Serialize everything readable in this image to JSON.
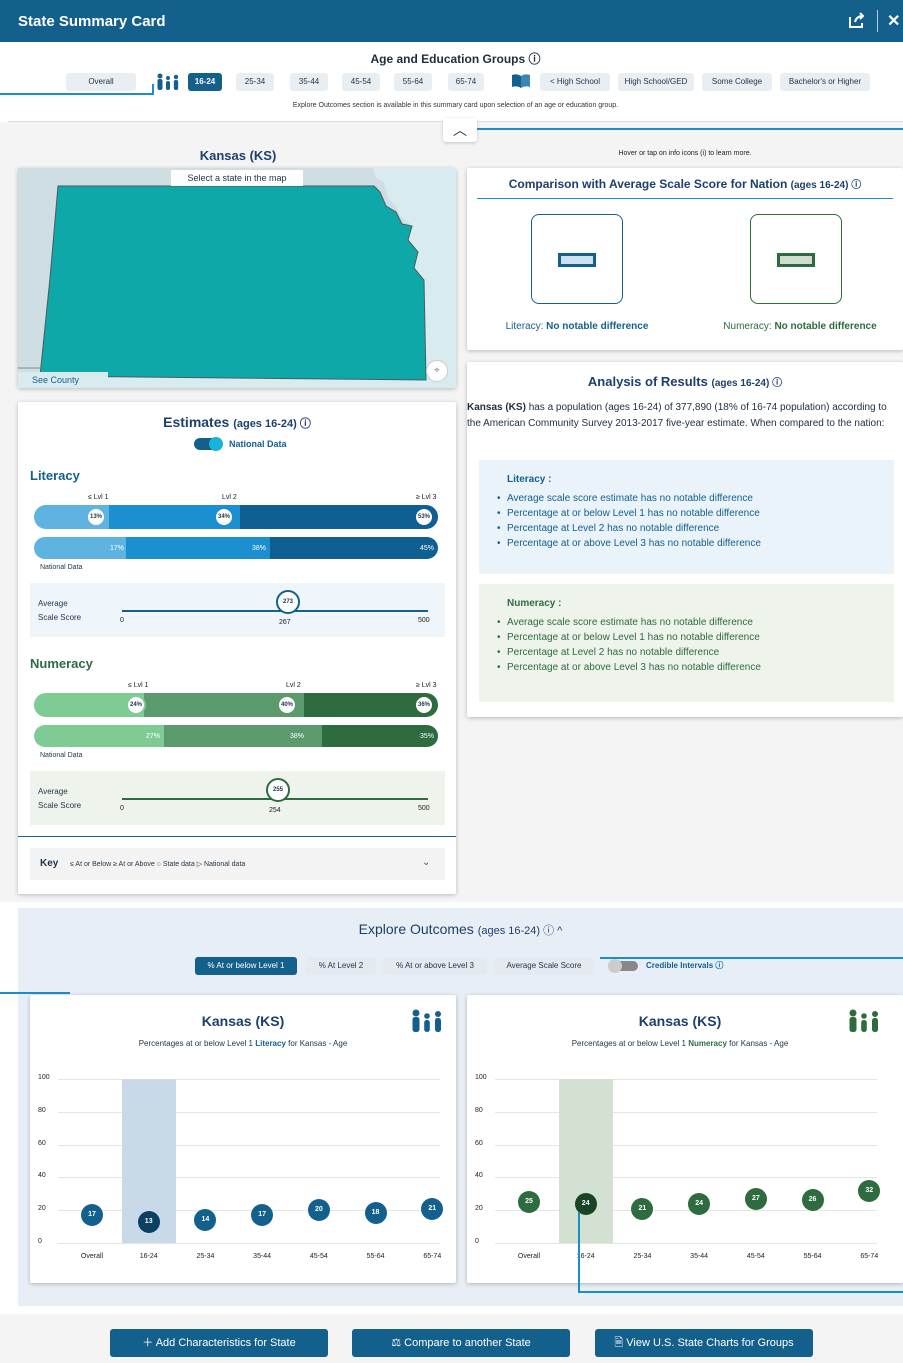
{
  "window": {
    "title": "State Summary Card"
  },
  "groups": {
    "title": "Age and Education Groups ⓘ",
    "overall": "Overall",
    "ages": [
      "16-24",
      "25-34",
      "35-44",
      "45-54",
      "55-64",
      "65-74"
    ],
    "selected_age": "16-24",
    "education": [
      "< High School",
      "High School/GED",
      "Some College",
      "Bachelor's or Higher"
    ],
    "note": "Explore Outcomes section is available in this summary card upon selection of an age or education group."
  },
  "hint": "Hover or tap on info icons (i) to learn more.",
  "map": {
    "state_title": "Kansas (KS)",
    "prompt": "Select a state in the map",
    "see_county": "See County"
  },
  "comparison": {
    "title": "Comparison with Average Scale Score for Nation",
    "title_suffix": "(ages 16-24) ⓘ",
    "literacy_label": "Literacy:",
    "literacy_value": "No notable difference",
    "numeracy_label": "Numeracy:",
    "numeracy_value": "No notable difference"
  },
  "analysis": {
    "title": "Analysis of Results",
    "title_suffix": "(ages 16-24) ⓘ",
    "state_bold": "Kansas (KS)",
    "intro": "has a population (ages 16-24) of 377,890 (18% of 16-74 population) according to the American Community Survey 2013-2017 five-year estimate. When compared to the nation:",
    "literacy_heading": "Literacy :",
    "literacy_items": [
      "Average scale score estimate has no notable difference",
      "Percentage at or below Level 1 has no notable difference",
      "Percentage at Level 2 has no notable difference",
      "Percentage at or above Level 3 has no notable difference"
    ],
    "numeracy_heading": "Numeracy :",
    "numeracy_items": [
      "Average scale score estimate has no notable difference",
      "Percentage at or below Level 1 has no notable difference",
      "Percentage at Level 2 has no notable difference",
      "Percentage at or above Level 3 has no notable difference"
    ]
  },
  "estimates": {
    "title": "Estimates",
    "title_suffix": "(ages 16-24) ⓘ",
    "toggle_label": "National Data",
    "level_labels": [
      "≤ Lvl 1",
      "Lvl 2",
      "≥ Lvl 3"
    ],
    "national_data_label": "National Data",
    "avg_label_1": "Average",
    "avg_label_2": "Scale Score",
    "scale_min": "0",
    "scale_max": "500",
    "literacy": {
      "heading": "Literacy",
      "state": [
        "13%",
        "34%",
        "53%"
      ],
      "national": [
        "17%",
        "38%",
        "45%"
      ],
      "state_score": "273",
      "national_score": "267"
    },
    "numeracy": {
      "heading": "Numeracy",
      "state": [
        "24%",
        "40%",
        "36%"
      ],
      "national": [
        "27%",
        "38%",
        "35%"
      ],
      "state_score": "255",
      "national_score": "254"
    },
    "key": {
      "label": "Key",
      "text": "≤ At or Below  ≥ At or Above  ○ State data  ▷ National data"
    }
  },
  "outcomes": {
    "title": "Explore Outcomes",
    "title_suffix": "(ages 16-24) ⓘ ^",
    "tabs": [
      "% At or below Level 1",
      "% At Level 2",
      "% At or above Level 3",
      "Average Scale Score"
    ],
    "credible_label": "Credible Intervals ⓘ",
    "literacy_chart": {
      "title": "Kansas (KS)",
      "subtitle_pre": "Percentages at or below Level 1",
      "subtitle_bold": "Literacy",
      "subtitle_post": "for Kansas - Age"
    },
    "numeracy_chart": {
      "title": "Kansas (KS)",
      "subtitle_pre": "Percentages at or below Level 1",
      "subtitle_bold": "Numeracy",
      "subtitle_post": "for Kansas - Age"
    }
  },
  "chart_data": [
    {
      "type": "scatter",
      "title": "Kansas (KS)",
      "subtitle": "Percentages at or below Level 1 Literacy for Kansas - Age",
      "categories": [
        "Overall",
        "16-24",
        "25-34",
        "35-44",
        "45-54",
        "55-64",
        "65-74"
      ],
      "values": [
        17,
        13,
        14,
        17,
        20,
        18,
        21
      ],
      "highlight": "16-24",
      "ylim": [
        0,
        100
      ],
      "yticks": [
        0,
        20,
        40,
        60,
        80,
        100
      ],
      "color": "#14608d",
      "highlight_color": "#c9d9e8"
    },
    {
      "type": "scatter",
      "title": "Kansas (KS)",
      "subtitle": "Percentages at or below Level 1 Numeracy for Kansas - Age",
      "categories": [
        "Overall",
        "16-24",
        "25-34",
        "35-44",
        "45-54",
        "55-64",
        "65-74"
      ],
      "values": [
        25,
        24,
        21,
        24,
        27,
        26,
        32
      ],
      "highlight": "16-24",
      "ylim": [
        0,
        100
      ],
      "yticks": [
        0,
        20,
        40,
        60,
        80,
        100
      ],
      "color": "#2e6b3f",
      "highlight_color": "#d3e1d3"
    }
  ],
  "footer": {
    "add": "Add Characteristics for State",
    "compare": "Compare to another State",
    "view": "View U.S. State Charts for Groups"
  },
  "colors": {
    "primary": "#14608d",
    "literacy": "#14608d",
    "numeracy": "#2e6b3f",
    "map_fill": "#0fa8a8"
  }
}
